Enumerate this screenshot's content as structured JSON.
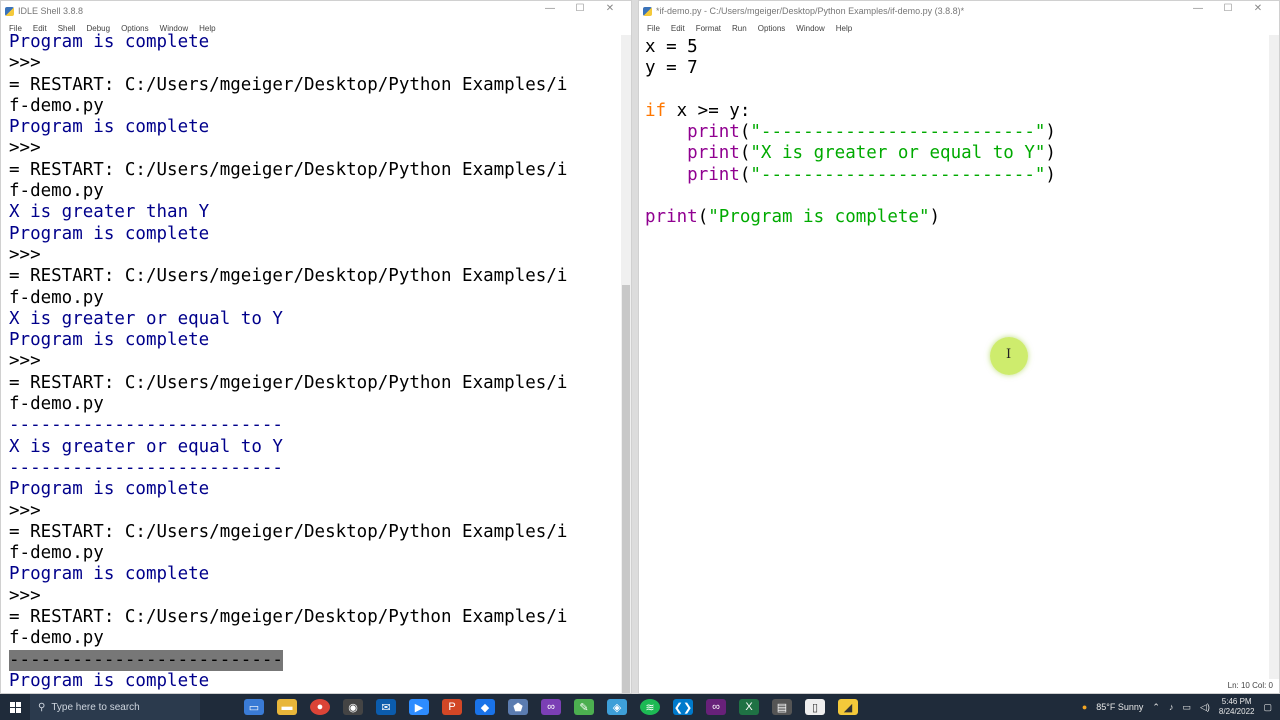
{
  "shell": {
    "title": "IDLE Shell 3.8.8",
    "menu": [
      "File",
      "Edit",
      "Shell",
      "Debug",
      "Options",
      "Window",
      "Help"
    ],
    "lines": [
      {
        "t": "Program is complete",
        "c": "out"
      },
      {
        "t": ">>> ",
        "c": "txt"
      },
      {
        "t": "= RESTART: C:/Users/mgeiger/Desktop/Python Examples/i",
        "c": "txt"
      },
      {
        "t": "f-demo.py",
        "c": "txt"
      },
      {
        "t": "Program is complete",
        "c": "out"
      },
      {
        "t": ">>> ",
        "c": "txt"
      },
      {
        "t": "= RESTART: C:/Users/mgeiger/Desktop/Python Examples/i",
        "c": "txt"
      },
      {
        "t": "f-demo.py",
        "c": "txt"
      },
      {
        "t": "X is greater than Y",
        "c": "out"
      },
      {
        "t": "Program is complete",
        "c": "out"
      },
      {
        "t": ">>> ",
        "c": "txt"
      },
      {
        "t": "= RESTART: C:/Users/mgeiger/Desktop/Python Examples/i",
        "c": "txt"
      },
      {
        "t": "f-demo.py",
        "c": "txt"
      },
      {
        "t": "X is greater or equal to Y",
        "c": "out"
      },
      {
        "t": "Program is complete",
        "c": "out"
      },
      {
        "t": ">>> ",
        "c": "txt"
      },
      {
        "t": "= RESTART: C:/Users/mgeiger/Desktop/Python Examples/i",
        "c": "txt"
      },
      {
        "t": "f-demo.py",
        "c": "txt"
      },
      {
        "t": "--------------------------",
        "c": "out"
      },
      {
        "t": "X is greater or equal to Y",
        "c": "out"
      },
      {
        "t": "--------------------------",
        "c": "out"
      },
      {
        "t": "Program is complete",
        "c": "out"
      },
      {
        "t": ">>> ",
        "c": "txt"
      },
      {
        "t": "= RESTART: C:/Users/mgeiger/Desktop/Python Examples/i",
        "c": "txt"
      },
      {
        "t": "f-demo.py",
        "c": "txt"
      },
      {
        "t": "Program is complete",
        "c": "out"
      },
      {
        "t": ">>> ",
        "c": "txt"
      },
      {
        "t": "= RESTART: C:/Users/mgeiger/Desktop/Python Examples/i",
        "c": "txt"
      },
      {
        "t": "f-demo.py",
        "c": "txt"
      },
      {
        "t": "--------------------------",
        "c": "sel"
      },
      {
        "t": "Program is complete",
        "c": "out"
      }
    ]
  },
  "editor": {
    "title": "*if-demo.py - C:/Users/mgeiger/Desktop/Python Examples/if-demo.py (3.8.8)*",
    "menu": [
      "File",
      "Edit",
      "Format",
      "Run",
      "Options",
      "Window",
      "Help"
    ],
    "code": [
      [
        {
          "t": "x = 5",
          "c": "txt"
        }
      ],
      [
        {
          "t": "y = 7",
          "c": "txt"
        }
      ],
      [],
      [
        {
          "t": "if",
          "c": "kw"
        },
        {
          "t": " x >= y:",
          "c": "txt"
        }
      ],
      [
        {
          "t": "    ",
          "c": "txt"
        },
        {
          "t": "print",
          "c": "builtin"
        },
        {
          "t": "(",
          "c": "txt"
        },
        {
          "t": "\"--------------------------\"",
          "c": "str"
        },
        {
          "t": ")",
          "c": "txt"
        }
      ],
      [
        {
          "t": "    ",
          "c": "txt"
        },
        {
          "t": "print",
          "c": "builtin"
        },
        {
          "t": "(",
          "c": "txt"
        },
        {
          "t": "\"X is greater or equal to Y\"",
          "c": "str"
        },
        {
          "t": ")",
          "c": "txt"
        }
      ],
      [
        {
          "t": "    ",
          "c": "txt"
        },
        {
          "t": "print",
          "c": "builtin"
        },
        {
          "t": "(",
          "c": "txt"
        },
        {
          "t": "\"--------------------------\"",
          "c": "str"
        },
        {
          "t": ")",
          "c": "txt"
        }
      ],
      [],
      [
        {
          "t": "print",
          "c": "builtin"
        },
        {
          "t": "(",
          "c": "txt"
        },
        {
          "t": "\"Program is complete\"",
          "c": "str"
        },
        {
          "t": ")",
          "c": "txt"
        }
      ]
    ],
    "status": "Ln: 10   Col: 0"
  },
  "taskbar": {
    "search_placeholder": "Type here to search",
    "weather": "85°F  Sunny",
    "time": "5:46 PM",
    "date": "8/24/2022"
  }
}
